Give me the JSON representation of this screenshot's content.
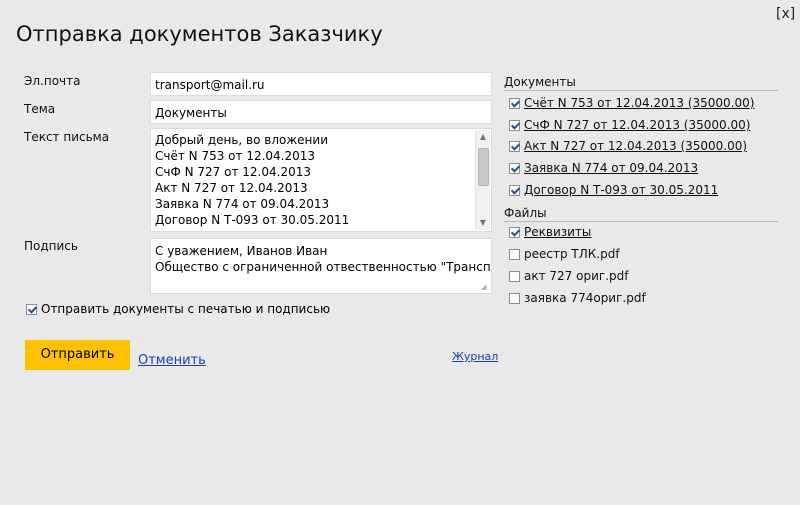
{
  "dialog": {
    "title": "Отправка документов Заказчику",
    "close_label": "[x]"
  },
  "form": {
    "email_label": "Эл.почта",
    "email_value": "transport@mail.ru",
    "subject_label": "Тема",
    "subject_value": "Документы",
    "body_label": "Текст письма",
    "body_lines": [
      "Добрый день, во вложении",
      "Счёт N 753 от 12.04.2013",
      "СчФ N 727 от 12.04.2013",
      "Акт N 727 от 12.04.2013",
      "Заявка N 774 от 09.04.2013",
      "Договор N Т-093 от 30.05.2011"
    ],
    "signature_label": "Подпись",
    "signature_lines": [
      "С уважением, Иванов Иван",
      "Общество с ограниченной отвественностью \"Транспорт\""
    ],
    "stamp_checkbox_label": "Отправить документы с печатью и подписью",
    "stamp_checked": true
  },
  "actions": {
    "send_label": "Отправить",
    "cancel_label": "Отменить",
    "journal_label": "Журнал"
  },
  "documents": {
    "heading": "Документы",
    "items": [
      {
        "label": "Счёт N 753 от 12.04.2013 (35000.00)",
        "checked": true
      },
      {
        "label": "СчФ N 727 от 12.04.2013 (35000.00)",
        "checked": true
      },
      {
        "label": "Акт N 727 от 12.04.2013 (35000.00)",
        "checked": true
      },
      {
        "label": "Заявка N 774 от 09.04.2013",
        "checked": true
      },
      {
        "label": "Договор N Т-093 от 30.05.2011",
        "checked": true
      }
    ]
  },
  "files": {
    "heading": "Файлы",
    "items": [
      {
        "label": "Реквизиты",
        "checked": true
      },
      {
        "label": "реестр ТЛК.pdf",
        "checked": false
      },
      {
        "label": "акт 727 ориг.pdf",
        "checked": false
      },
      {
        "label": "заявка 774ориг.pdf",
        "checked": false
      }
    ]
  },
  "colors": {
    "background": "#e9e9e9",
    "send_button": "#ffc200",
    "link": "#1b3fb0"
  }
}
